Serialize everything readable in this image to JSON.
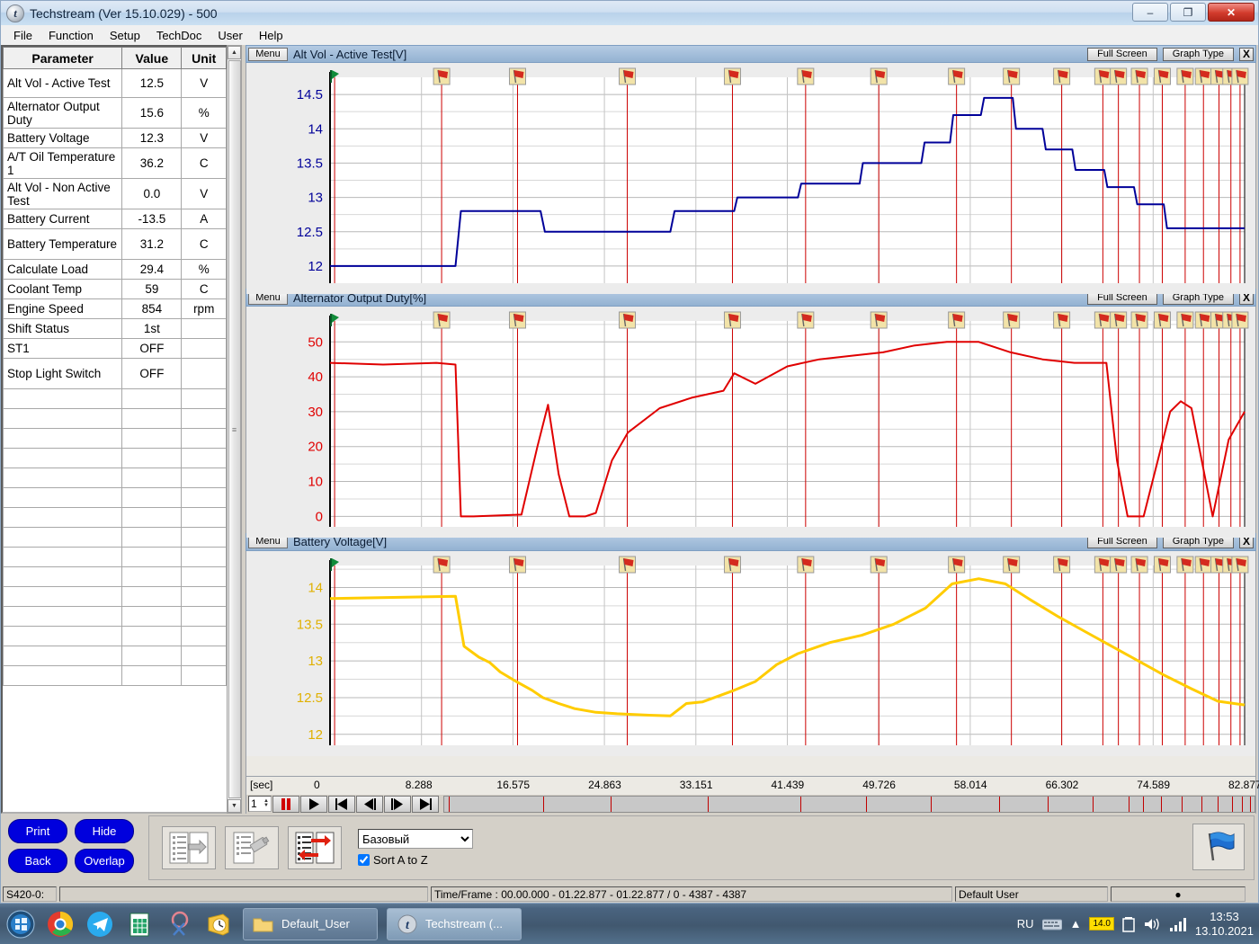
{
  "window": {
    "title": "Techstream (Ver 15.10.029) - 500",
    "app_icon": "t",
    "minimize": "–",
    "maximize": "❐",
    "close": "✕"
  },
  "menu": {
    "items": [
      "File",
      "Function",
      "Setup",
      "TechDoc",
      "User",
      "Help"
    ]
  },
  "param_grid": {
    "headers": [
      "Parameter",
      "Value",
      "Unit"
    ],
    "rows": [
      {
        "parameter": "Alt Vol - Active Test",
        "value": "12.5",
        "unit": "V",
        "color": "blue"
      },
      {
        "parameter": "Alternator Output Duty",
        "value": "15.6",
        "unit": "%",
        "color": "red"
      },
      {
        "parameter": "Battery Voltage",
        "value": "12.3",
        "unit": "V",
        "color": "yellow"
      },
      {
        "parameter": "A/T Oil Temperature 1",
        "value": "36.2",
        "unit": "C",
        "color": "black"
      },
      {
        "parameter": "Alt Vol - Non Active Test",
        "value": "0.0",
        "unit": "V",
        "color": "black"
      },
      {
        "parameter": "Battery Current",
        "value": "-13.5",
        "unit": "A",
        "color": "black"
      },
      {
        "parameter": "Battery Temperature",
        "value": "31.2",
        "unit": "C",
        "color": "black"
      },
      {
        "parameter": "Calculate Load",
        "value": "29.4",
        "unit": "%",
        "color": "black"
      },
      {
        "parameter": "Coolant Temp",
        "value": "59",
        "unit": "C",
        "color": "black"
      },
      {
        "parameter": "Engine Speed",
        "value": "854",
        "unit": "rpm",
        "color": "black"
      },
      {
        "parameter": "Shift Status",
        "value": "1st",
        "unit": "",
        "color": "black"
      },
      {
        "parameter": "ST1",
        "value": "OFF",
        "unit": "",
        "color": "black"
      },
      {
        "parameter": "Stop Light Switch",
        "value": "OFF",
        "unit": "",
        "color": "black"
      }
    ],
    "empty_rows": 15
  },
  "graph_controls": {
    "menu": "Menu",
    "full_screen": "Full Screen",
    "graph_type": "Graph Type",
    "close": "X"
  },
  "chart_data": [
    {
      "type": "line",
      "title": "Alt Vol - Active Test[V]",
      "series_name": "Alt Vol - Active Test",
      "color": "#000099",
      "xlabel": "[sec]",
      "ylabel": "V",
      "ylim": [
        11.75,
        14.75
      ],
      "yticks": [
        12,
        12.5,
        13,
        13.5,
        14,
        14.5
      ],
      "xlim": [
        0,
        86
      ],
      "grid": true,
      "x": [
        0,
        11.8,
        12.3,
        19.8,
        20.2,
        32.0,
        32.4,
        38.0,
        38.3,
        44.0,
        44.3,
        49.8,
        50.1,
        55.6,
        55.9,
        58.3,
        58.6,
        61.2,
        61.5,
        64.2,
        64.5,
        67.0,
        67.3,
        69.8,
        70.1,
        72.8,
        73.1,
        75.6,
        75.9,
        78.4,
        78.7,
        86
      ],
      "y": [
        12.0,
        12.0,
        12.8,
        12.8,
        12.5,
        12.5,
        12.8,
        12.8,
        13.0,
        13.0,
        13.2,
        13.2,
        13.5,
        13.5,
        13.8,
        13.8,
        14.2,
        14.2,
        14.45,
        14.45,
        14.0,
        14.0,
        13.7,
        13.7,
        13.4,
        13.4,
        13.15,
        13.15,
        12.9,
        12.9,
        12.55,
        12.55
      ]
    },
    {
      "type": "line",
      "title": "Alternator Output Duty[%]",
      "series_name": "Alternator Output Duty",
      "color": "#e00000",
      "xlabel": "[sec]",
      "ylabel": "%",
      "ylim": [
        -3,
        56
      ],
      "yticks": [
        0,
        10,
        20,
        30,
        40,
        50
      ],
      "xlim": [
        0,
        86
      ],
      "grid": true,
      "x": [
        0,
        5,
        10,
        11.8,
        12.3,
        13.5,
        18.0,
        19.5,
        20.5,
        21.5,
        22.5,
        24.0,
        25.0,
        26.5,
        28.0,
        31.0,
        34.0,
        37.0,
        38.0,
        40.0,
        43.0,
        46.0,
        49.0,
        52.0,
        55.0,
        58.0,
        61.0,
        64.0,
        67.0,
        70.0,
        73.0,
        74.0,
        75.0,
        76.5,
        79.0,
        80.0,
        81.0,
        83.0,
        84.5,
        86
      ],
      "y": [
        44,
        43.5,
        44,
        43.5,
        0,
        0,
        0.5,
        20,
        32,
        12,
        0,
        0,
        1,
        16,
        24,
        31,
        34,
        36,
        41,
        38,
        43,
        45,
        46,
        47,
        49,
        50,
        50,
        47,
        45,
        44,
        44,
        16,
        0,
        0,
        30,
        33,
        31,
        0,
        22,
        30
      ]
    },
    {
      "type": "line",
      "title": "Battery Voltage[V]",
      "series_name": "Battery Voltage",
      "color": "#ffcc00",
      "xlabel": "[sec]",
      "ylabel": "V",
      "ylim": [
        11.85,
        14.3
      ],
      "yticks": [
        12,
        12.5,
        13,
        13.5,
        14
      ],
      "xlim": [
        0,
        86
      ],
      "grid": true,
      "x": [
        0,
        11.8,
        12.6,
        14.0,
        15.0,
        16.0,
        17.5,
        19.0,
        20.0,
        21.5,
        23.0,
        25.0,
        27.0,
        30.0,
        32.0,
        33.5,
        35.0,
        38.0,
        40.0,
        42.0,
        44.0,
        47.0,
        50.0,
        53.0,
        56.0,
        58.5,
        61.0,
        63.5,
        66.0,
        68.5,
        71.0,
        73.5,
        76.0,
        78.5,
        81.0,
        83.5,
        86
      ],
      "y": [
        13.85,
        13.88,
        13.2,
        13.05,
        12.98,
        12.85,
        12.72,
        12.6,
        12.5,
        12.42,
        12.35,
        12.3,
        12.28,
        12.26,
        12.25,
        12.42,
        12.44,
        12.6,
        12.72,
        12.95,
        13.1,
        13.25,
        13.35,
        13.5,
        13.72,
        14.05,
        14.12,
        14.05,
        13.82,
        13.6,
        13.4,
        13.2,
        13.0,
        12.8,
        12.62,
        12.45,
        12.4
      ]
    }
  ],
  "time_axis": {
    "unit_label": "[sec]",
    "ticks": [
      "0",
      "8.288",
      "16.575",
      "24.863",
      "33.151",
      "41.439",
      "49.726",
      "58.014",
      "66.302",
      "74.589",
      "82.877"
    ]
  },
  "transport": {
    "frame_number": "1",
    "buttons": [
      "pause",
      "play",
      "skip-to-start",
      "step-back",
      "step-forward",
      "skip-to-end"
    ]
  },
  "bottom_buttons": {
    "items": [
      "Print",
      "Hide",
      "Back",
      "Overlap"
    ]
  },
  "toolbar": {
    "tool1": "compare-lists-icon",
    "tool2": "save-snapshot-icon",
    "tool3": "swap-lists-icon",
    "mode_select": {
      "selected": "Базовый",
      "options": [
        "Базовый"
      ]
    },
    "sort_checkbox": {
      "label": "Sort A to Z",
      "checked": true
    },
    "flag_button": "blue-flag-icon"
  },
  "statusbar": {
    "left": "S420-0:",
    "center": "Time/Frame : 00.00.000 - 01.22.877 - 01.22.877 / 0 - 4387 - 4387",
    "user": "Default User"
  },
  "taskbar": {
    "start": "windows-start-icon",
    "quick_icons": [
      "chrome-icon",
      "telegram-icon",
      "excel-icon",
      "snipping-tool-icon",
      "outlook-icon"
    ],
    "items": [
      {
        "label": "Default_User",
        "icon": "folder-icon",
        "active": false
      },
      {
        "label": "Techstream (...",
        "icon": "techstream-icon",
        "active": true
      }
    ],
    "tray": {
      "language": "RU",
      "badge": "14.0",
      "time": "13:53",
      "date": "13.10.2021"
    }
  },
  "markers": {
    "start_flag": "green-flag",
    "event_flags_count": 19,
    "positions": [
      0.005,
      0.122,
      0.205,
      0.325,
      0.44,
      0.52,
      0.6,
      0.685,
      0.745,
      0.8,
      0.845,
      0.862,
      0.885,
      0.91,
      0.935,
      0.955,
      0.972,
      0.985,
      0.995
    ]
  }
}
